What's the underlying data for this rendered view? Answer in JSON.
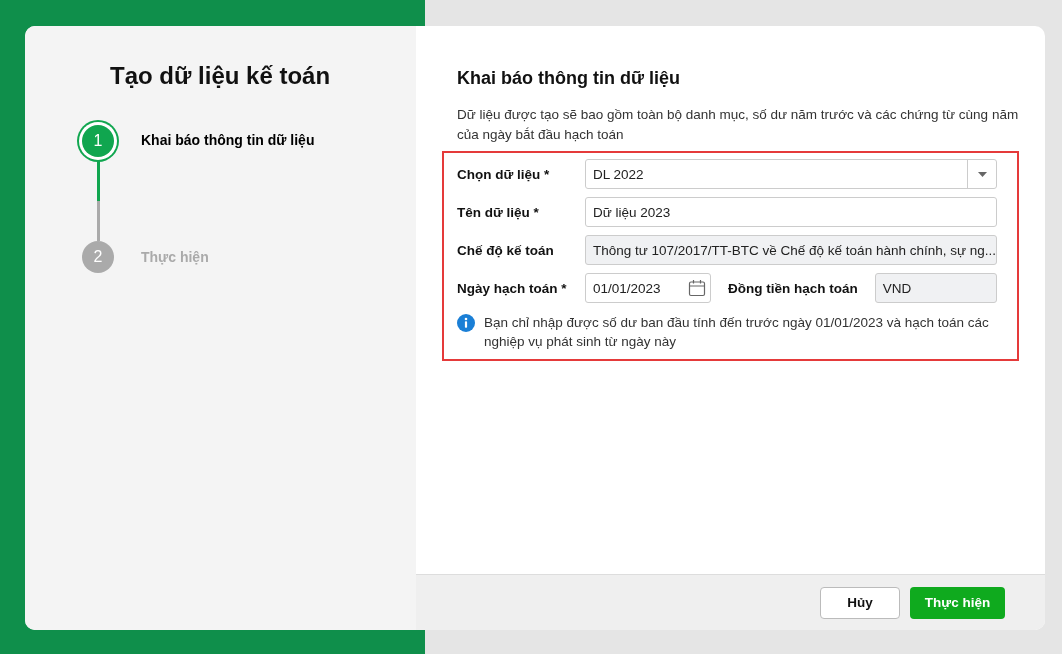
{
  "wizard": {
    "title": "Tạo dữ liệu kế toán",
    "steps": [
      {
        "number": "1",
        "label": "Khai báo thông tin dữ liệu",
        "active": true
      },
      {
        "number": "2",
        "label": "Thực hiện",
        "active": false
      }
    ]
  },
  "form": {
    "title": "Khai báo thông tin dữ liệu",
    "description": "Dữ liệu được tạo sẽ bao gồm toàn bộ danh mục, số dư năm trước và các chứng từ cùng năm của ngày bắt đầu hạch toán",
    "rows": [
      {
        "fields": [
          {
            "kind": "select",
            "label": "Chọn dữ liệu *",
            "value": "DL 2022"
          }
        ]
      },
      {
        "fields": [
          {
            "kind": "text",
            "label": "Tên dữ liệu *",
            "value": "Dữ liệu 2023"
          }
        ]
      },
      {
        "fields": [
          {
            "kind": "readonly",
            "label": "Chế độ kế toán",
            "value": "Thông tư 107/2017/TT-BTC về Chế độ kế toán hành chính, sự ng..."
          }
        ]
      },
      {
        "fields": [
          {
            "kind": "date",
            "label": "Ngày hạch toán *",
            "value": "01/01/2023"
          },
          {
            "kind": "readonly",
            "label": "Đồng tiền hạch toán",
            "value": "VND"
          }
        ]
      }
    ],
    "note": "Bạn chỉ nhập được số dư ban đầu tính đến trước ngày 01/01/2023 và hạch toán các nghiệp vụ phát sinh từ ngày này"
  },
  "buttons": [
    {
      "kind": "secondary",
      "label": "Hủy"
    },
    {
      "kind": "primary",
      "label": "Thực hiện"
    }
  ]
}
